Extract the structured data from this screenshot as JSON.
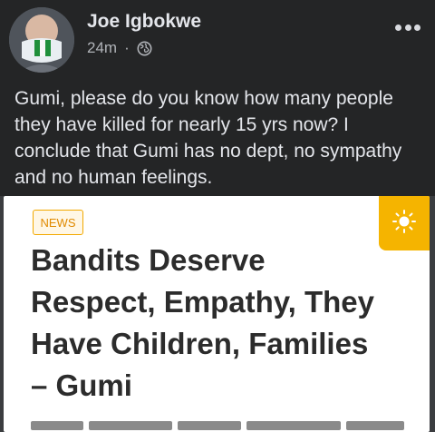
{
  "post": {
    "author": "Joe Igbokwe",
    "time": "24m",
    "separator": "·",
    "privacy_icon": "globe-icon",
    "more_icon": "more-horizontal-icon",
    "text": "Gumi, please do you know how many people they have killed for nearly 15 yrs now? I conclude that Gumi has no dept, no sympathy and no human feelings."
  },
  "shared_card": {
    "badge": "NEWS",
    "badge_color": "#f2a900",
    "corner_icon": "sun-icon",
    "corner_color": "#f5b400",
    "headline_lines": [
      "Bandits Deserve",
      "Respect, Empathy, They",
      "Have Children, Families",
      "– Gumi"
    ]
  },
  "colors": {
    "background": "#242526",
    "text_primary": "#e4e6eb",
    "text_secondary": "#b0b3b8"
  }
}
